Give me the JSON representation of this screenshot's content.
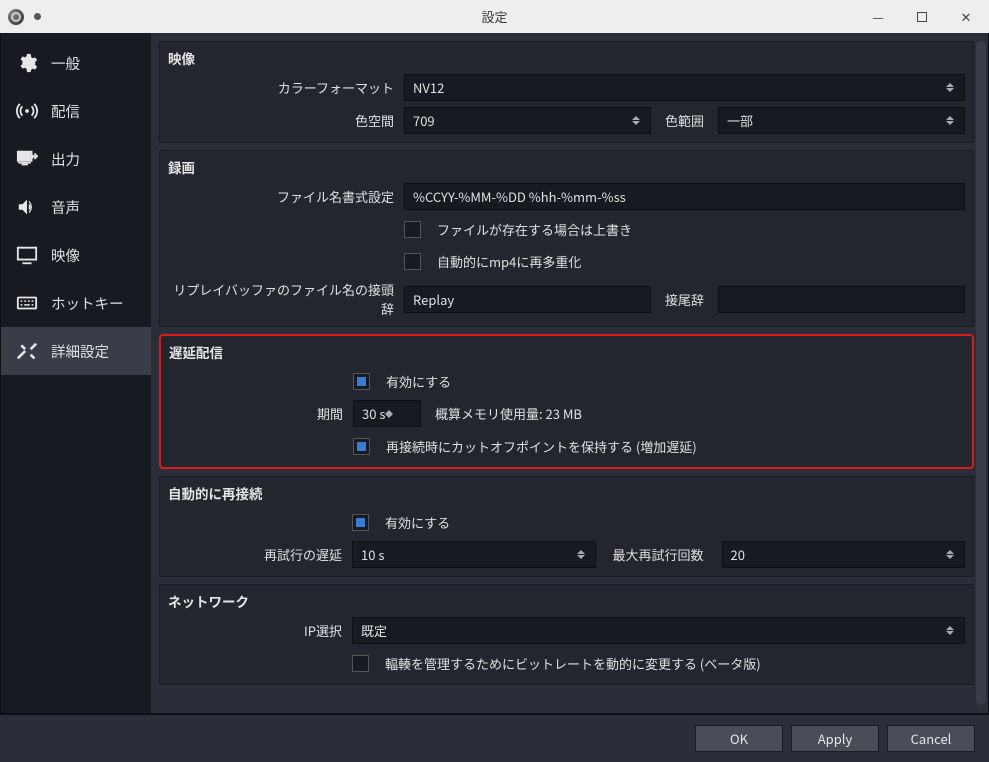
{
  "window": {
    "title": "設定"
  },
  "sidebar": {
    "items": [
      {
        "label": "一般"
      },
      {
        "label": "配信"
      },
      {
        "label": "出力"
      },
      {
        "label": "音声"
      },
      {
        "label": "映像"
      },
      {
        "label": "ホットキー"
      },
      {
        "label": "詳細設定"
      }
    ]
  },
  "groups": {
    "video": {
      "title": "映像",
      "color_format_label": "カラーフォーマット",
      "color_format_value": "NV12",
      "color_space_label": "色空間",
      "color_space_value": "709",
      "color_range_label": "色範囲",
      "color_range_value": "一部"
    },
    "recording": {
      "title": "録画",
      "filename_fmt_label": "ファイル名書式設定",
      "filename_fmt_value": "%CCYY-%MM-%DD %hh-%mm-%ss",
      "overwrite_label": "ファイルが存在する場合は上書き",
      "remux_label": "自動的にmp4に再多重化",
      "replay_prefix_label": "リプレイバッファのファイル名の接頭辞",
      "replay_prefix_value": "Replay",
      "replay_suffix_label": "接尾辞",
      "replay_suffix_value": ""
    },
    "delay": {
      "title": "遅延配信",
      "enable_label": "有効にする",
      "duration_label": "期間",
      "duration_value": "30 s",
      "mem_label": "概算メモリ使用量: 23 MB",
      "preserve_label": "再接続時にカットオフポイントを保持する (増加遅延)"
    },
    "reconnect": {
      "title": "自動的に再接続",
      "enable_label": "有効にする",
      "retry_delay_label": "再試行の遅延",
      "retry_delay_value": "10 s",
      "max_retries_label": "最大再試行回数",
      "max_retries_value": "20"
    },
    "network": {
      "title": "ネットワーク",
      "ip_select_label": "IP選択",
      "ip_select_value": "既定",
      "dyn_bitrate_label": "輻輳を管理するためにビットレートを動的に変更する (ベータ版)"
    }
  },
  "footer": {
    "ok": "OK",
    "apply": "Apply",
    "cancel": "Cancel"
  }
}
